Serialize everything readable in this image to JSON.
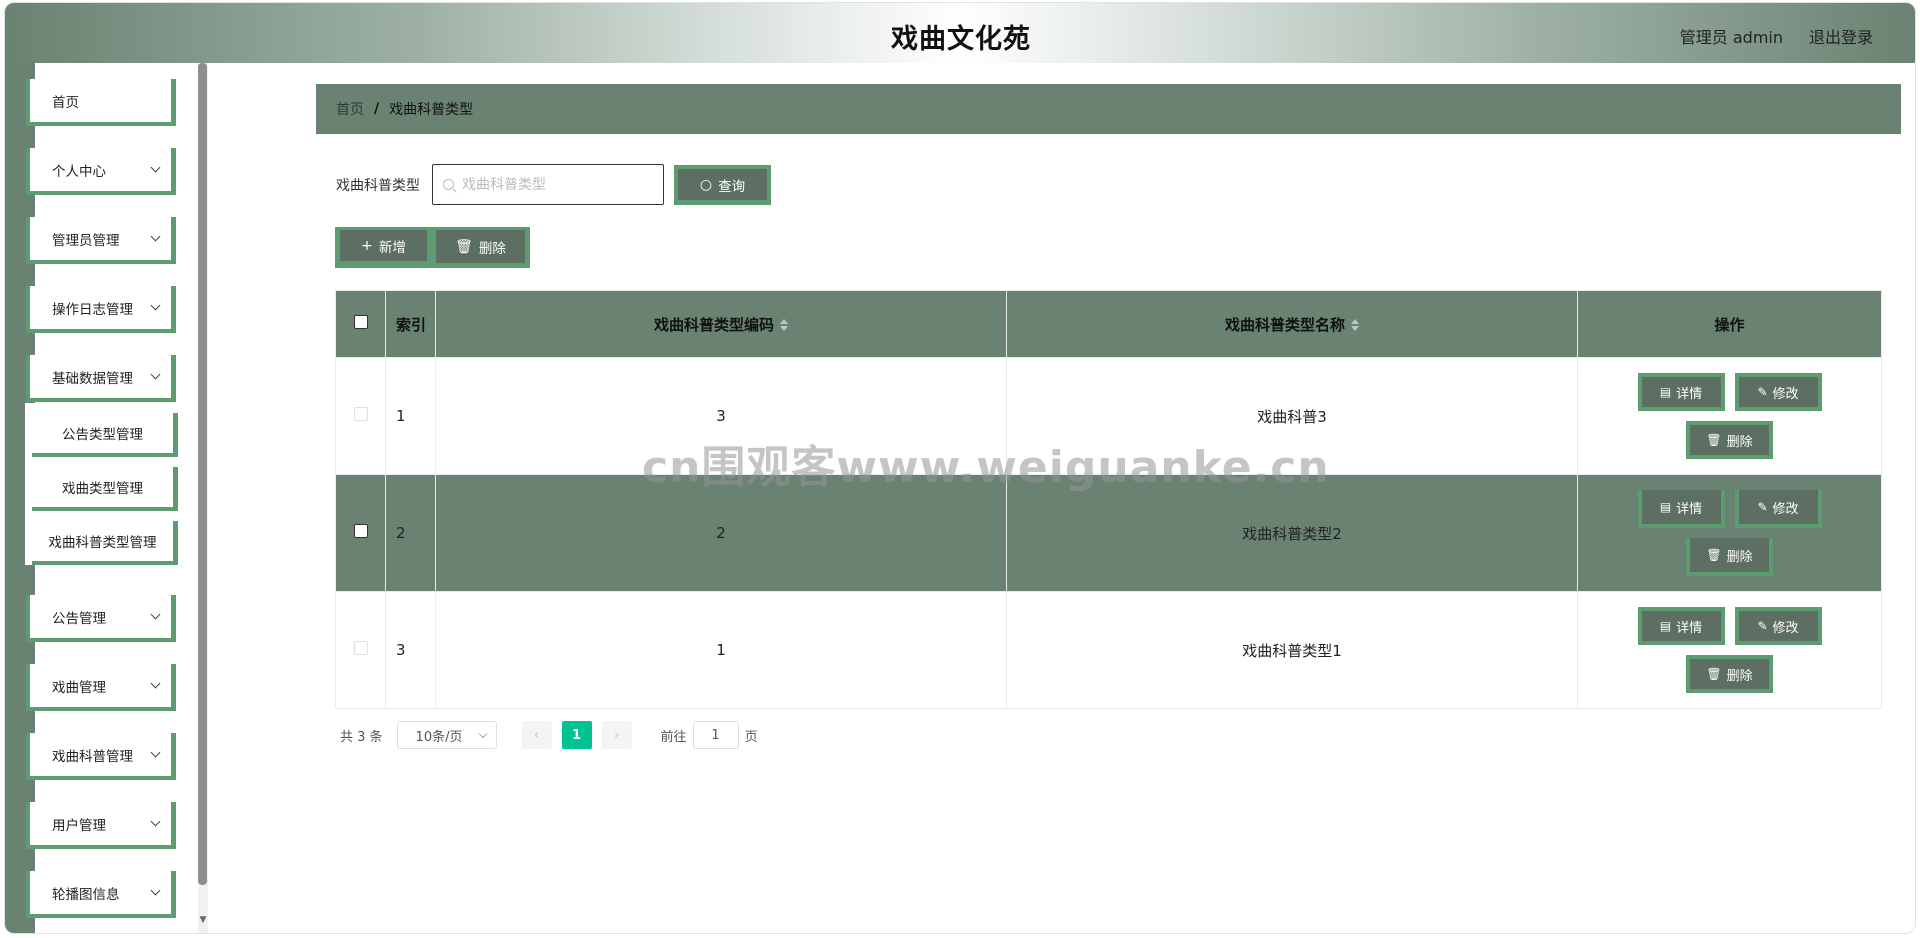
{
  "header": {
    "title": "戏曲文化苑",
    "user": "管理员 admin",
    "logout": "退出登录"
  },
  "sidebar": {
    "items": [
      {
        "label": "首页",
        "has_children": false
      },
      {
        "label": "个人中心",
        "has_children": true
      },
      {
        "label": "管理员管理",
        "has_children": true
      },
      {
        "label": "操作日志管理",
        "has_children": true
      },
      {
        "label": "基础数据管理",
        "has_children": true,
        "expanded": true
      },
      {
        "label": "公告管理",
        "has_children": true
      },
      {
        "label": "戏曲管理",
        "has_children": true
      },
      {
        "label": "戏曲科普管理",
        "has_children": true
      },
      {
        "label": "用户管理",
        "has_children": true
      },
      {
        "label": "轮播图信息",
        "has_children": true
      }
    ],
    "submenu": [
      "公告类型管理",
      "戏曲类型管理",
      "戏曲科普类型管理"
    ]
  },
  "breadcrumb": {
    "home": "首页",
    "separator": "/",
    "current": "戏曲科普类型"
  },
  "search": {
    "label": "戏曲科普类型",
    "placeholder": "戏曲科普类型",
    "value": "",
    "button": "查询"
  },
  "toolbar": {
    "add": "新增",
    "delete": "删除"
  },
  "table": {
    "columns": [
      "索引",
      "戏曲科普类型编码",
      "戏曲科普类型名称",
      "操作"
    ],
    "rows": [
      {
        "index": "1",
        "code": "3",
        "name": "戏曲科普3"
      },
      {
        "index": "2",
        "code": "2",
        "name": "戏曲科普类型2"
      },
      {
        "index": "3",
        "code": "1",
        "name": "戏曲科普类型1"
      }
    ],
    "actions": {
      "detail": "详情",
      "edit": "修改",
      "delete": "删除"
    }
  },
  "pagination": {
    "total": "共 3 条",
    "page_size": "10条/页",
    "current": "1",
    "goto_prefix": "前往",
    "goto_value": "1",
    "goto_suffix": "页"
  },
  "watermark": "cn围观客www.weiguanke.cn",
  "colors": {
    "primary": "#6a8272",
    "accent_border": "#5c9c70",
    "button_bg": "#5d6f62",
    "page_active": "#00c292"
  },
  "icons": {
    "search": "search-icon",
    "add": "plus-icon",
    "delete": "trash-icon",
    "detail": "document-icon",
    "edit": "edit-icon",
    "chevron": "chevron-down-icon"
  }
}
